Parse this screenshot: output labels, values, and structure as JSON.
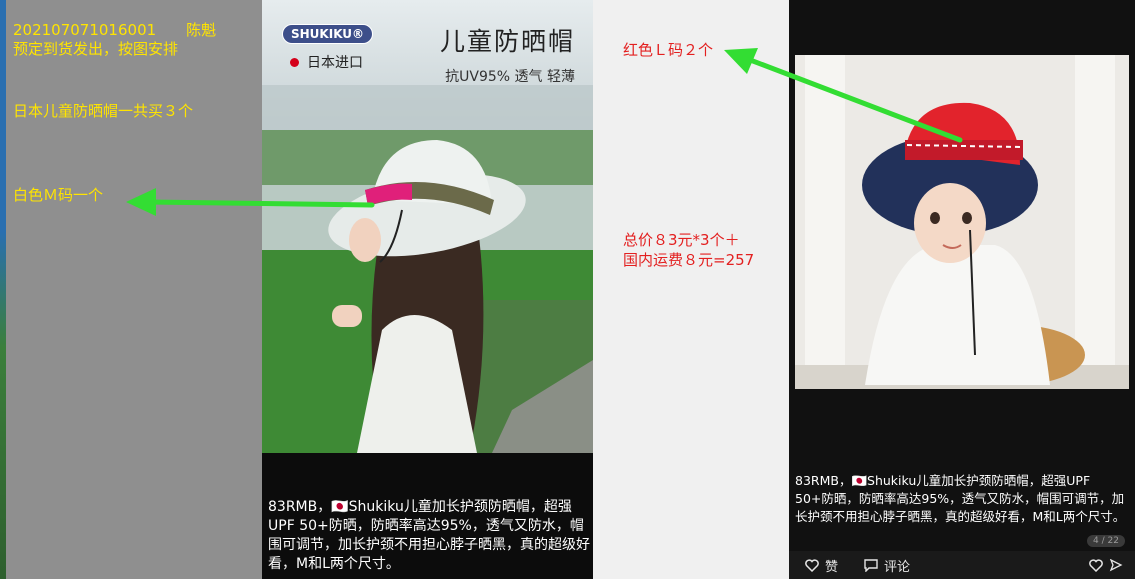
{
  "left_notes": {
    "line1": "20210707101600​1　　陈魁",
    "line2": "预定到货发出，按图安排",
    "total_line": "日本儿童防晒帽一共买３个",
    "white_m": "白色Ｍ码一个"
  },
  "post1": {
    "brand_badge": "SHUKIKU®",
    "origin": "日本进口",
    "title": "儿童防晒帽",
    "subtitle": "抗UV95% 透气 轻薄",
    "caption": "83RMB，🇯🇵Shukiku儿童加长护颈防晒帽，超强UPF 50+防晒，防晒率高达95%，透气又防水，帽围可调节，加长护颈不用担心脖子晒黑，真的超级好看，M和L两个尺寸。"
  },
  "mid_notes": {
    "red_l": "红色Ｌ码２个",
    "price_line1": "总价８3元*3个＋",
    "price_line2": "国内运费８元=257"
  },
  "post2": {
    "caption": "83RMB，🇯🇵Shukiku儿童加长护颈防晒帽，超强UPF 50+防晒，防晒率高达95%，透气又防水，帽围可调节，加长护颈不用担心脖子晒黑，真的超级好看，M和L两个尺寸。",
    "pager": "4 / 22",
    "like_label": "赞",
    "comment_label": "评论"
  },
  "icons": [
    "flag-jp-icon",
    "heart-icon",
    "comment-icon",
    "heart-icon"
  ],
  "colors": {
    "annotation_yellow": "#ffe400",
    "annotation_red": "#e32020",
    "arrow_green": "#33dd33"
  }
}
